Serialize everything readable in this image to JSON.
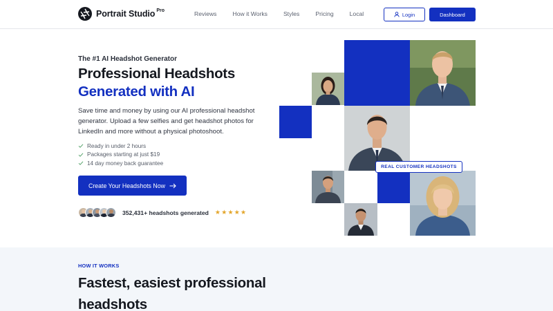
{
  "brand": {
    "name": "Portrait Studio",
    "sup": "Pro"
  },
  "nav": {
    "links": [
      "Reviews",
      "How it Works",
      "Styles",
      "Pricing",
      "Local"
    ],
    "login_label": "Login",
    "dashboard_label": "Dashboard"
  },
  "hero": {
    "eyebrow": "The #1 AI Headshot Generator",
    "title_line1": "Professional Headshots",
    "title_line2": "Generated with AI",
    "description": "Save time and money by using our AI professional headshot generator. Upload a few selfies and get headshot photos for LinkedIn and more without a physical photoshoot.",
    "checks": [
      "Ready in under 2 hours",
      "Packages starting at just $19",
      "14 day money back guarantee"
    ],
    "cta_label": "Create Your Headshots Now",
    "social_proof": "352,431+ headshots generated",
    "stars": "★★★★★",
    "badge": "REAL CUSTOMER HEADSHOTS"
  },
  "how_it_works": {
    "eyebrow": "HOW IT WORKS",
    "title": "Fastest, easiest professional headshots"
  },
  "colors": {
    "brand_blue": "#1330c0",
    "star": "#e3a52a",
    "section_bg": "#f3f6fa"
  }
}
